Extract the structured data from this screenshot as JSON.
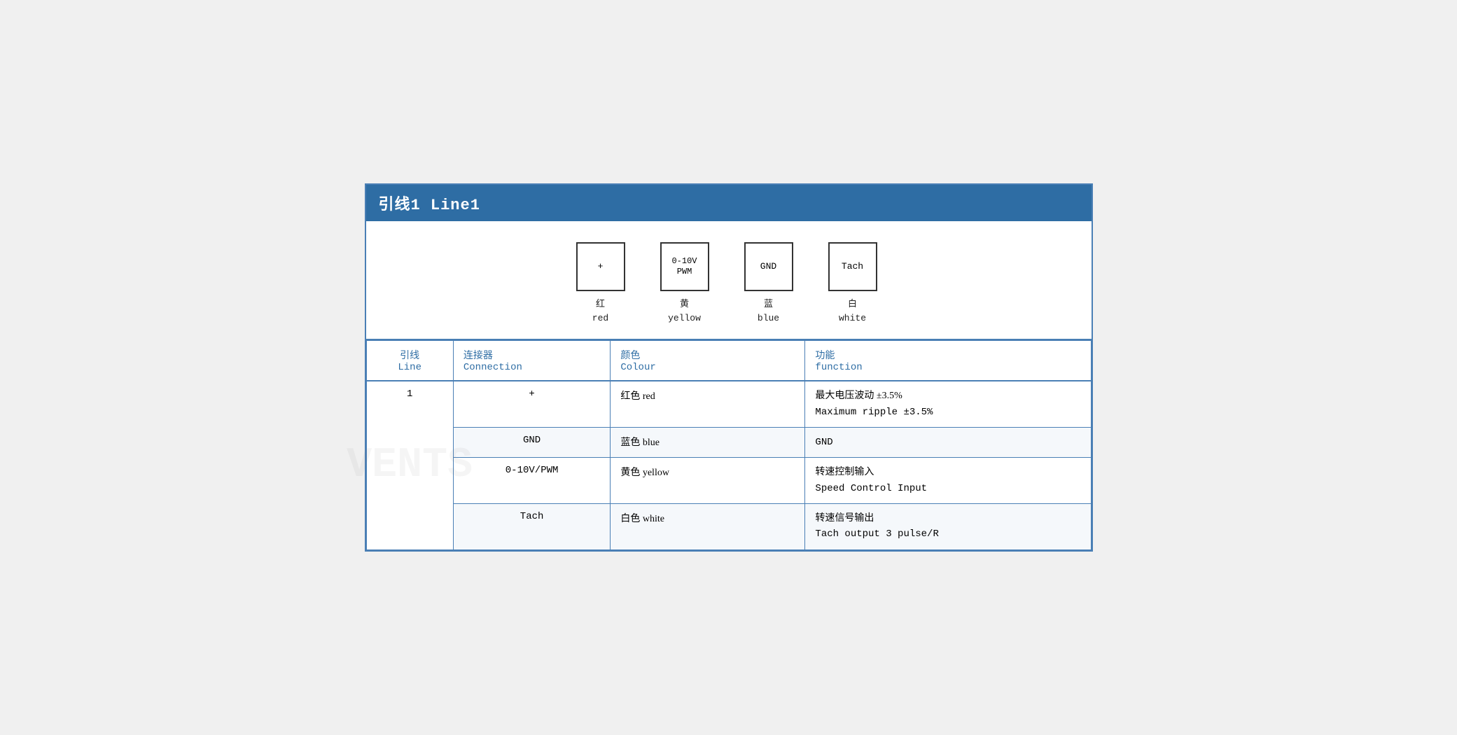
{
  "title": "引线1 Line1",
  "diagram": {
    "pins": [
      {
        "id": "pin-plus",
        "symbol": "+",
        "zh": "红",
        "en": "red"
      },
      {
        "id": "pin-pwm",
        "symbol": "0-10V\nPWM",
        "zh": "黄",
        "en": "yellow"
      },
      {
        "id": "pin-gnd",
        "symbol": "GND",
        "zh": "蓝",
        "en": "blue"
      },
      {
        "id": "pin-tach",
        "symbol": "Tach",
        "zh": "白",
        "en": "white"
      }
    ]
  },
  "table": {
    "headers": {
      "line_zh": "引线",
      "line_en": "Line",
      "connector_zh": "连接器",
      "connector_en": "Connection",
      "colour_zh": "颜色",
      "colour_en": "Colour",
      "function_zh": "功能",
      "function_en": "function"
    },
    "rows": [
      {
        "line": "1",
        "connector": "+",
        "colour_zh": "红色 red",
        "function_zh": "最大电压波动 ±3.5%",
        "function_en": "Maximum ripple ±3.5%"
      },
      {
        "line": "",
        "connector": "GND",
        "colour_zh": "蓝色 blue",
        "function_zh": "GND",
        "function_en": ""
      },
      {
        "line": "",
        "connector": "0-10V/PWM",
        "colour_zh": "黄色 yellow",
        "function_zh": "转速控制输入",
        "function_en": "Speed Control Input"
      },
      {
        "line": "",
        "connector": "Tach",
        "colour_zh": "白色 white",
        "function_zh": "转速信号输出",
        "function_en": "Tach output 3 pulse/R"
      }
    ]
  },
  "watermark": "VENTS"
}
